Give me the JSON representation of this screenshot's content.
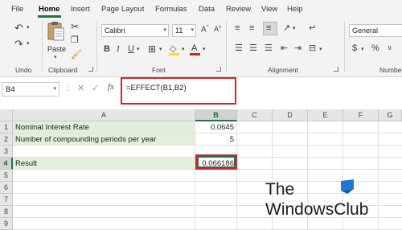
{
  "menu": {
    "items": [
      "File",
      "Home",
      "Insert",
      "Page Layout",
      "Formulas",
      "Data",
      "Review",
      "View",
      "Help"
    ],
    "active": "Home"
  },
  "ribbon": {
    "undo_label": "Undo",
    "clipboard_label": "Clipboard",
    "paste_label": "Paste",
    "font_label": "Font",
    "font_name": "Calibri",
    "font_size": "11",
    "alignment_label": "Alignment",
    "number_format": "General",
    "number_label": "Numbe"
  },
  "formula_bar": {
    "name_box": "B4",
    "fx_label": "fx",
    "formula": "=EFFECT(B1,B2)"
  },
  "grid": {
    "columns": [
      "A",
      "B",
      "C",
      "D",
      "E",
      "F",
      "G"
    ],
    "selected_column": "B",
    "row_numbers": [
      "1",
      "2",
      "3",
      "4",
      "5",
      "6",
      "7",
      "8",
      "9"
    ],
    "selected_row": "4",
    "rows": [
      {
        "a": "Nominal Interest Rate",
        "b": "0.0645"
      },
      {
        "a": "Number of compounding periods per  year",
        "b": "5"
      },
      {
        "a": "",
        "b": ""
      },
      {
        "a": "Result",
        "b": "0.066186"
      }
    ]
  },
  "watermark": {
    "line1": "The",
    "line2": "WindowsClub"
  },
  "colors": {
    "accent_green": "#217346",
    "highlight_red": "#d9222a",
    "cell_fill": "#e2efda",
    "logo_blue": "#1e78d2"
  }
}
